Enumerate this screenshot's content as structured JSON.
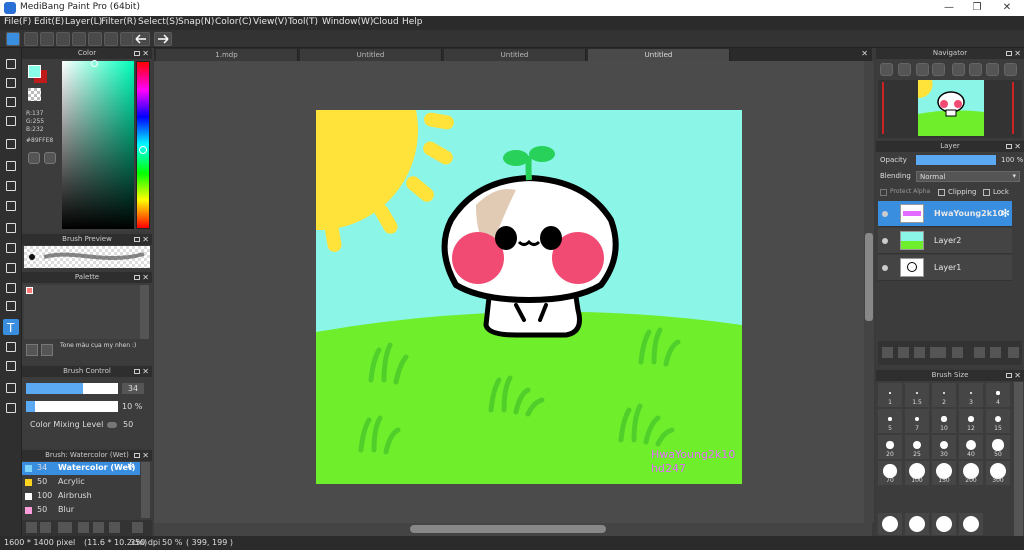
{
  "window": {
    "title": "MediBang Paint Pro (64bit)",
    "minimize": "—",
    "maximize": "❐",
    "close": "✕"
  },
  "menu": [
    "File(F)",
    "Edit(E)",
    "Layer(L)",
    "Filter(R)",
    "Select(S)",
    "Snap(N)",
    "Color(C)",
    "View(V)",
    "Tool(T)",
    "Window(W)",
    "Cloud",
    "Help"
  ],
  "tabs": [
    "1.mdp",
    "Untitled",
    "Untitled",
    "Untitled"
  ],
  "color": {
    "title": "Color",
    "r": "R:137",
    "g": "G:255",
    "b": "B:232",
    "hex": "#89FFE8",
    "fg": "#89ffe8",
    "bg": "#c01a1a"
  },
  "brush_preview": {
    "title": "Brush Preview"
  },
  "palette": {
    "title": "Palette",
    "note": "Tone màu cụa my nhen :)"
  },
  "brush_control": {
    "title": "Brush Control",
    "size": "34",
    "opacity": "10 %",
    "mixing_label": "Color Mixing Level",
    "mixing_value": "50",
    "size_level": 0.62,
    "opacity_level": 0.1
  },
  "brush_list": {
    "title": "Brush: Watercolor (Wet)",
    "items": [
      {
        "size": "34",
        "name": "Watercolor (Wet)",
        "color": "#7fd3ff"
      },
      {
        "size": "50",
        "name": "Acrylic",
        "color": "#ffd21f"
      },
      {
        "size": "100",
        "name": "Airbrush",
        "color": "#ffffff"
      },
      {
        "size": "50",
        "name": "Blur",
        "color": "#ff9edb"
      }
    ]
  },
  "navigator": {
    "title": "Navigator"
  },
  "layer": {
    "title": "Layer",
    "opacity_label": "Opacity",
    "opacity_value": "100 %",
    "blending_label": "Blending",
    "blending_value": "Normal",
    "protect_alpha": "Protect Alpha",
    "clipping": "Clipping",
    "lock": "Lock",
    "layers": [
      "HwaYoung2k10",
      "Layer2",
      "Layer1"
    ]
  },
  "brush_size": {
    "title": "Brush Size",
    "sizes": [
      "1",
      "1.5",
      "2",
      "3",
      "4",
      "5",
      "7",
      "10",
      "12",
      "15",
      "20",
      "25",
      "30",
      "40",
      "50",
      "70",
      "100",
      "150",
      "200",
      "300"
    ]
  },
  "canvas": {
    "signature": "HwaYoung2k10\nhd247"
  },
  "status": {
    "size": "1600 * 1400 pixel",
    "cm": "(11.6 * 10.2cm)",
    "dpi": "350 dpi",
    "zoom": "50 %",
    "coords": "( 399, 199 )"
  }
}
